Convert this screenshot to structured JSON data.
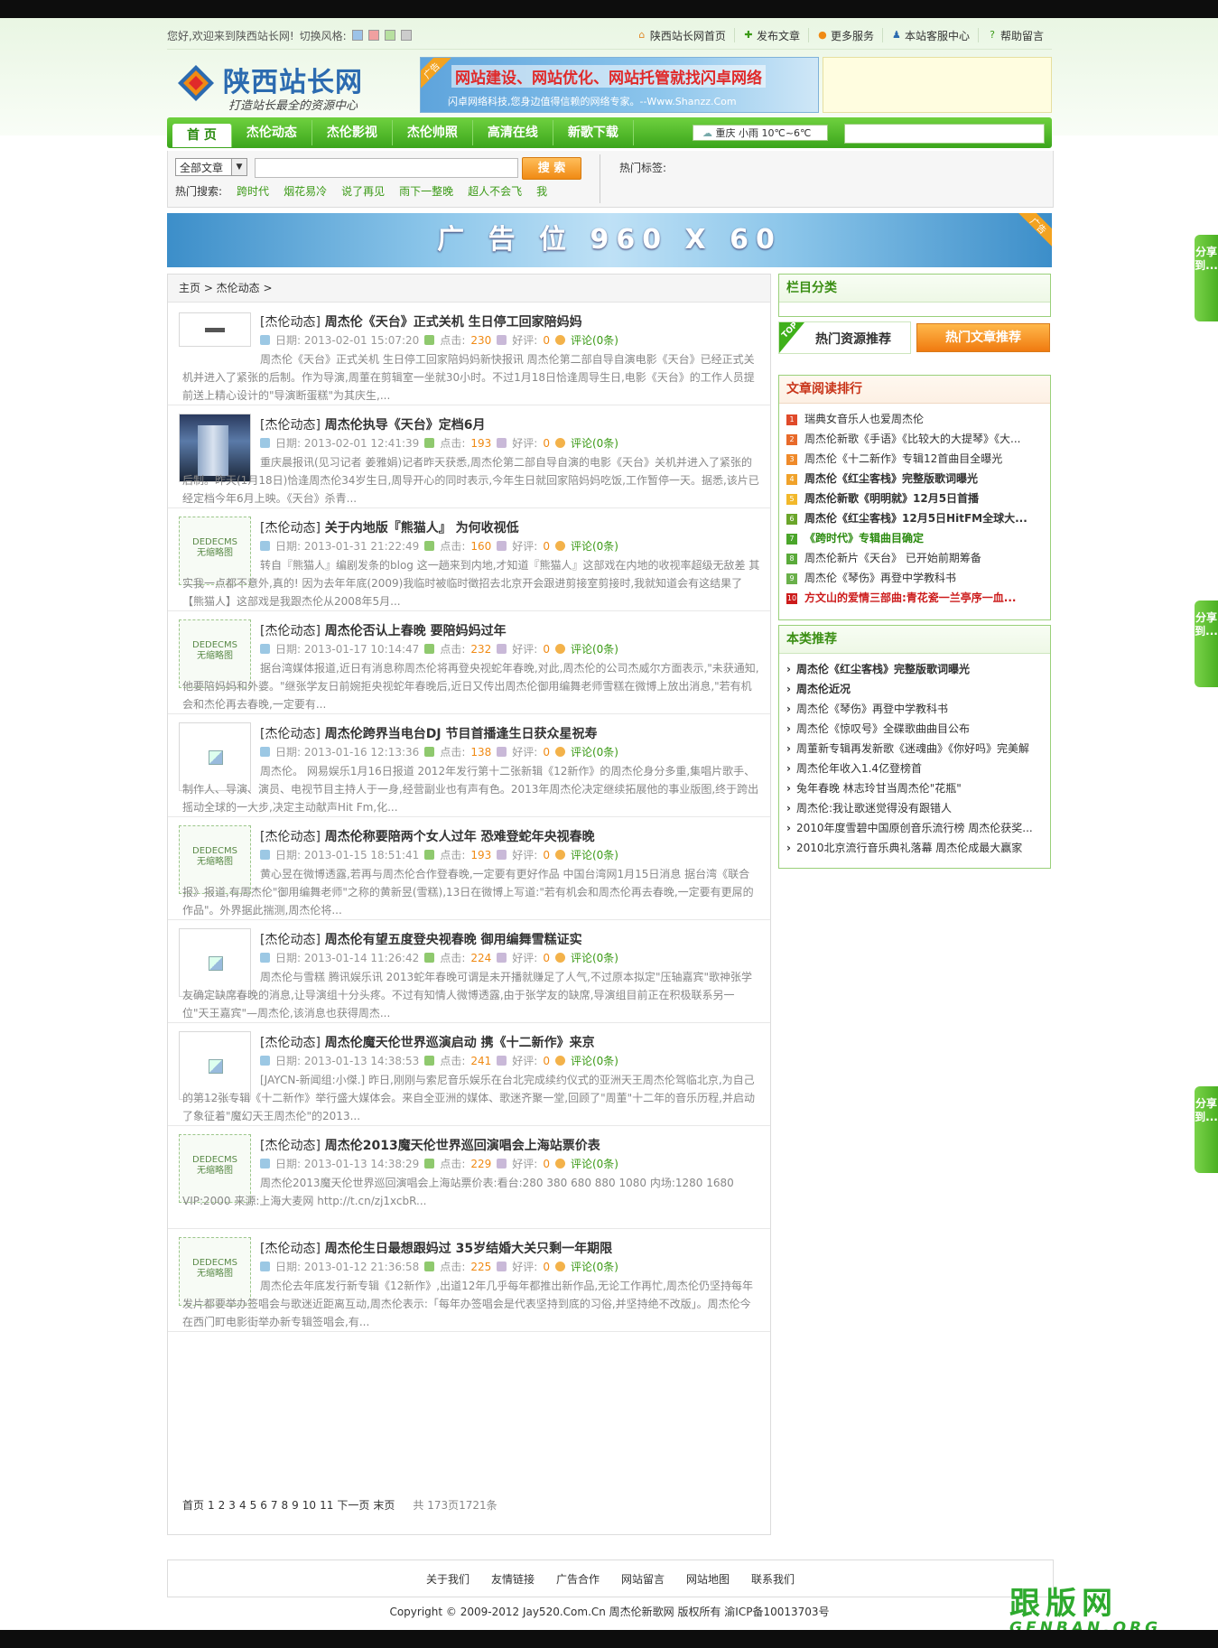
{
  "topbar": {
    "welcome": "您好,欢迎来到陕西站长网!",
    "switch_style": "切换风格:",
    "style_colors": [
      "#9cc3e8",
      "#f0a0a0",
      "#b7e0a0",
      "#cccccc"
    ],
    "links": [
      {
        "label": "陕西站长网首页",
        "icon": "home-icon"
      },
      {
        "label": "发布文章",
        "icon": "plus-icon"
      },
      {
        "label": "更多服务",
        "icon": "service-icon"
      },
      {
        "label": "本站客服中心",
        "icon": "user-icon"
      },
      {
        "label": "帮助留言",
        "icon": "help-icon"
      }
    ]
  },
  "logo": {
    "name": "陕西站长网",
    "slogan": "打造站长最全的资源中心"
  },
  "ad_banner": {
    "tag": "广告",
    "title": "网站建设、网站优化、网站托管就找闪卓网络",
    "subtitle": "闪卓网络科技,您身边值得信赖的网络专家。--Www.Shanzz.Com"
  },
  "nav": {
    "items": [
      "首 页",
      "杰伦动态",
      "杰伦影视",
      "杰伦帅照",
      "高清在线",
      "新歌下载"
    ],
    "weather": "重庆  小雨 10℃~6℃"
  },
  "search": {
    "scope": "全部文章",
    "button": "搜 索",
    "hot_label": "热门搜索:",
    "hot_keywords": [
      "跨时代",
      "烟花易冷",
      "说了再见",
      "雨下一整晚",
      "超人不会飞",
      "我"
    ],
    "hot_tags_label": "热门标签:"
  },
  "big_banner": {
    "text": "广 告 位 960 X 60",
    "tag": "广告"
  },
  "breadcrumb": "主页 > 杰伦动态 >",
  "meta_labels": {
    "date": "日期:",
    "clicks": "点击:",
    "rating": "好评:",
    "comments": "评论(0条)"
  },
  "no_thumb": {
    "line1": "DEDECMS",
    "line2": "无缩略图"
  },
  "articles": [
    {
      "cat": "[杰伦动态]",
      "title": "周杰伦《天台》正式关机 生日停工回家陪妈妈",
      "date": "2013-02-01 15:07:20",
      "clicks": "230",
      "rating": "0",
      "thumb": "logo",
      "desc": "周杰伦《天台》正式关机 生日停工回家陪妈妈新快报讯 周杰伦第二部自导自演电影《天台》已经正式关机并进入了紧张的后制。作为导演,周董在剪辑室一坐就30小时。不过1月18日恰逢周导生日,电影《天台》的工作人员提前送上精心设计的\"导演断蛋糕\"为其庆生,..."
    },
    {
      "cat": "[杰伦动态]",
      "title": "周杰伦执导《天台》定档6月",
      "date": "2013-02-01 12:41:39",
      "clicks": "193",
      "rating": "0",
      "thumb": "photo",
      "desc": "重庆晨报讯(见习记者 姜雅娟)记者昨天获悉,周杰伦第二部自导自演的电影《天台》关机并进入了紧张的后制。昨天(1月18日)恰逢周杰伦34岁生日,周导开心的同时表示,今年生日就回家陪妈妈吃饭,工作暂停一天。据悉,该片已经定档今年6月上映。《天台》杀青..."
    },
    {
      "cat": "[杰伦动态]",
      "title": "关于内地版『熊猫人』 为何收视低",
      "date": "2013-01-31 21:22:49",
      "clicks": "160",
      "rating": "0",
      "thumb": "none",
      "desc": "转自『熊猫人』编剧发条的blog 这一趟来到内地,才知道『熊猫人』这部戏在内地的收视率超级无敌差 其实我一点都不意外,真的! 因为去年年底(2009)我临时被临时徵招去北京开会跟进剪接室剪接时,我就知道会有这结果了 【熊猫人】这部戏是我跟杰伦从2008年5月..."
    },
    {
      "cat": "[杰伦动态]",
      "title": "周杰伦否认上春晚 要陪妈妈过年",
      "date": "2013-01-17 10:14:47",
      "clicks": "232",
      "rating": "0",
      "thumb": "none",
      "desc": "据台湾媒体报道,近日有消息称周杰伦将再登央视蛇年春晚,对此,周杰伦的公司杰威尔方面表示,\"未获通知,他要陪妈妈和外婆。\"继张学友日前婉拒央视蛇年春晚后,近日又传出周杰伦御用编舞老师雪糕在微博上放出消息,\"若有机会和杰伦再去春晚,一定要有..."
    },
    {
      "cat": "[杰伦动态]",
      "title": "周杰伦跨界当电台DJ 节目首播逢生日获众星祝寿",
      "date": "2013-01-16 12:13:36",
      "clicks": "138",
      "rating": "0",
      "thumb": "broken",
      "desc": "周杰伦。 网易娱乐1月16日报道 2012年发行第十二张新辑《12新作》的周杰伦身分多重,集唱片歌手、制作人、导演、演员、电视节目主持人于一身,经营副业也有声有色。2013年周杰伦决定继续拓展他的事业版图,终于跨出摇动全球的一大步,决定主动献声Hit Fm,化..."
    },
    {
      "cat": "[杰伦动态]",
      "title": "周杰伦称要陪两个女人过年 恐难登蛇年央视春晚",
      "date": "2013-01-15 18:51:41",
      "clicks": "193",
      "rating": "0",
      "thumb": "none",
      "desc": "黄心昱在微博透露,若再与周杰伦合作登春晚,一定要有更好作品 中国台湾网1月15日消息 据台湾《联合报》报道,有周杰伦\"御用编舞老师\"之称的黄新昱(雪糕),13日在微博上写道:\"若有机会和周杰伦再去春晚,一定要有更屌的作品\"。外界据此揣测,周杰伦将..."
    },
    {
      "cat": "[杰伦动态]",
      "title": "周杰伦有望五度登央视春晚 御用编舞雪糕证实",
      "date": "2013-01-14 11:26:42",
      "clicks": "224",
      "rating": "0",
      "thumb": "broken",
      "desc": "周杰伦与雪糕 腾讯娱乐讯 2013蛇年春晚可谓是未开播就赚足了人气,不过原本拟定\"压轴嘉宾\"歌神张学友确定缺席春晚的消息,让导演组十分头疼。不过有知情人微博透露,由于张学友的缺席,导演组目前正在积极联系另一位\"天王嘉宾\"—周杰伦,该消息也获得周杰..."
    },
    {
      "cat": "[杰伦动态]",
      "title": "周杰伦魔天伦世界巡演启动 携《十二新作》来京",
      "date": "2013-01-13 14:38:53",
      "clicks": "241",
      "rating": "0",
      "thumb": "broken",
      "desc": "[JAYCN-新闻组:小傑.] 昨日,刚刚与索尼音乐娱乐在台北完成续约仪式的亚洲天王周杰伦驾临北京,为自己的第12张专辑《十二新作》举行盛大媒体会。来自全亚洲的媒体、歌迷齐聚一堂,回顾了\"周董\"十二年的音乐历程,并启动了象征着\"魔幻天王周杰伦\"的2013..."
    },
    {
      "cat": "[杰伦动态]",
      "title": "周杰伦2013魔天伦世界巡回演唱会上海站票价表",
      "date": "2013-01-13 14:38:29",
      "clicks": "229",
      "rating": "0",
      "thumb": "none",
      "desc": "周杰伦2013魔天伦世界巡回演唱会上海站票价表:看台:280 380 680 880 1080 内场:1280 1680 VIP:2000 来源:上海大麦网 http://t.cn/zj1xcbR..."
    },
    {
      "cat": "[杰伦动态]",
      "title": "周杰伦生日最想跟妈过 35岁结婚大关只剩一年期限",
      "date": "2013-01-12 21:36:58",
      "clicks": "225",
      "rating": "0",
      "thumb": "none",
      "desc": "周杰伦去年底发行新专辑《12新作》,出道12年几乎每年都推出新作品,无论工作再忙,周杰伦仍坚持每年发片都要举办签唱会与歌迷近距离互动,周杰伦表示:「每年办签唱会是代表坚持到底的习俗,并坚持绝不改版」。周杰伦今在西门町电影街举办新专辑签唱会,有..."
    }
  ],
  "pagination": {
    "first": "首页",
    "pages": [
      "1",
      "2",
      "3",
      "4",
      "5",
      "6",
      "7",
      "8",
      "9",
      "10",
      "11"
    ],
    "next": "下一页",
    "last": "末页",
    "total": "共 173页1721条"
  },
  "sidebar": {
    "category_title": "栏目分类",
    "tab_hot_res": "热门资源推荐",
    "tab_hot_art": "热门文章推荐",
    "top_label": "TOP",
    "ranking_title": "文章阅读排行",
    "ranking": [
      {
        "n": "1",
        "text": "瑞典女音乐人也爱周杰伦",
        "bold": false,
        "color": "#333333",
        "badge": "#e04a2a"
      },
      {
        "n": "2",
        "text": "周杰伦新歌《手语》《比较大的大提琴》《大...",
        "bold": false,
        "color": "#333333",
        "badge": "#e86a2a"
      },
      {
        "n": "3",
        "text": "周杰伦《十二新作》专辑12首曲目全曝光",
        "bold": false,
        "color": "#333333",
        "badge": "#ef8a2a"
      },
      {
        "n": "4",
        "text": "周杰伦《红尘客栈》完整版歌词曝光",
        "bold": true,
        "color": "#333333",
        "badge": "#f0a22a"
      },
      {
        "n": "5",
        "text": "周杰伦新歌《明明就》12月5日首播",
        "bold": true,
        "color": "#333333",
        "badge": "#f2b82a"
      },
      {
        "n": "6",
        "text": "周杰伦《红尘客栈》12月5日HitFM全球大...",
        "bold": true,
        "color": "#333333",
        "badge": "#6aa52a"
      },
      {
        "n": "7",
        "text": "《跨时代》专辑曲目确定",
        "bold": true,
        "color": "#2a8a0e",
        "badge": "#4aa52a"
      },
      {
        "n": "8",
        "text": "周杰伦新片《天台》 已开始前期筹备",
        "bold": false,
        "color": "#333333",
        "badge": "#5aaa3a"
      },
      {
        "n": "9",
        "text": "周杰伦《琴伤》再登中学教科书",
        "bold": false,
        "color": "#333333",
        "badge": "#6ab04a"
      },
      {
        "n": "10",
        "text": "方文山的爱情三部曲:青花瓷一兰亭序一血...",
        "bold": true,
        "color": "#cc1a1a",
        "badge": "#cc1a1a"
      }
    ],
    "recommend_title": "本类推荐",
    "recommend": [
      {
        "text": "周杰伦《红尘客栈》完整版歌词曝光",
        "bold": true
      },
      {
        "text": "周杰伦近况",
        "bold": true
      },
      {
        "text": "周杰伦《琴伤》再登中学教科书",
        "bold": false
      },
      {
        "text": "周杰伦《惊叹号》全碟歌曲曲目公布",
        "bold": false
      },
      {
        "text": "周董新专辑再发新歌《迷魂曲》《你好吗》完美解",
        "bold": false
      },
      {
        "text": "周杰伦年收入1.4亿登榜首",
        "bold": false
      },
      {
        "text": "兔年春晚 林志玲甘当周杰伦\"花瓶\"",
        "bold": false
      },
      {
        "text": "周杰伦:我让歌迷觉得没有跟错人",
        "bold": false
      },
      {
        "text": "2010年度雪碧中国原创音乐流行榜 周杰伦获奖...",
        "bold": false
      },
      {
        "text": "2010北京流行音乐典礼落幕 周杰伦成最大赢家",
        "bold": false
      }
    ]
  },
  "footer": {
    "links": [
      "关于我们",
      "友情链接",
      "广告合作",
      "网站留言",
      "网站地图",
      "联系我们"
    ],
    "copyright": "Copyright © 2009-2012 Jay520.Com.Cn 周杰伦新歌网 版权所有  渝ICP备10013703号"
  },
  "watermark": {
    "cn": "跟版网",
    "en": "GENBAN.ORG"
  },
  "share_label": "分享到..."
}
